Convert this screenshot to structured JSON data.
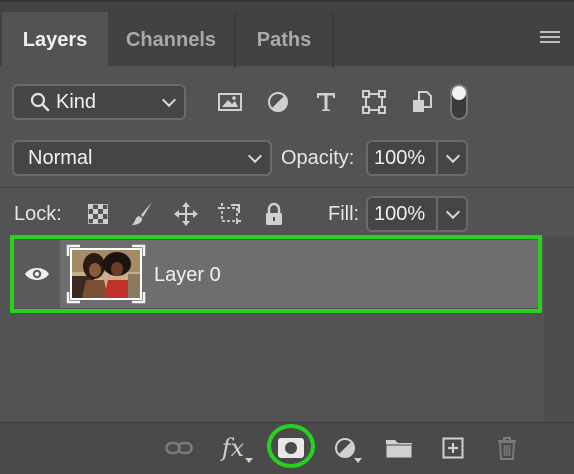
{
  "tabs": [
    {
      "label": "Layers",
      "active": true
    },
    {
      "label": "Channels",
      "active": false
    },
    {
      "label": "Paths",
      "active": false
    }
  ],
  "filter": {
    "kind_label": "Kind",
    "icons": [
      "image-filter-icon",
      "adjustment-filter-icon",
      "type-filter-icon",
      "shape-filter-icon",
      "smart-object-filter-icon"
    ],
    "toggle_on": true
  },
  "blend": {
    "mode": "Normal",
    "opacity_label": "Opacity:",
    "opacity_value": "100%"
  },
  "lock": {
    "label": "Lock:",
    "icons": [
      "lock-transparent-pixels-icon",
      "lock-image-pixels-icon",
      "lock-position-icon",
      "lock-artboard-icon",
      "lock-all-icon"
    ],
    "fill_label": "Fill:",
    "fill_value": "100%"
  },
  "layers": [
    {
      "name": "Layer 0",
      "visible": true,
      "selected": true
    }
  ],
  "bottom_toolbar": [
    "link-layers-icon",
    "fx-icon",
    "add-mask-icon",
    "adjustment-layer-icon",
    "group-folder-icon",
    "new-layer-icon",
    "delete-icon"
  ],
  "colors": {
    "highlight": "#27d21e",
    "panel": "#535353",
    "tabbar": "#424242"
  }
}
